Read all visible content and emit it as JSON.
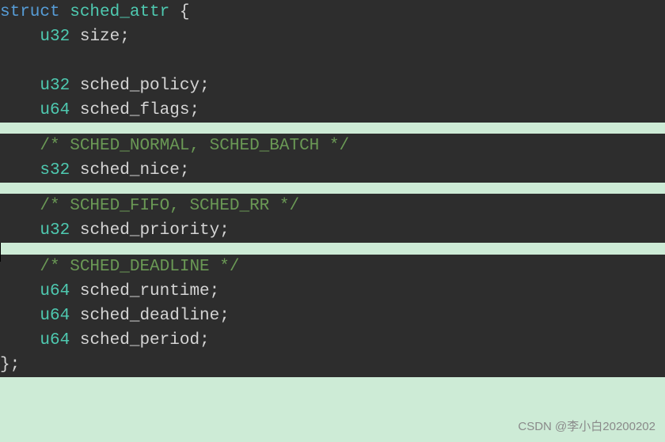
{
  "watermark": "CSDN @李小白20200202",
  "code": {
    "line1_kw": "struct",
    "line1_type": " sched_attr ",
    "line1_brace": "{",
    "indent": "    ",
    "line2_type": "u32",
    "line2_id": " size",
    "semi": ";",
    "line4_type": "u32",
    "line4_id": " sched_policy",
    "line5_type": "u64",
    "line5_id": " sched_flags",
    "comment1": "/* SCHED_NORMAL, SCHED_BATCH */",
    "line7_type": "s32",
    "line7_id": " sched_nice",
    "comment2": "/* SCHED_FIFO, SCHED_RR */",
    "line9_type": "u32",
    "line9_id": " sched_priority",
    "comment3": "/* SCHED_DEADLINE */",
    "line11_type": "u64",
    "line11_id": " sched_runtime",
    "line12_type": "u64",
    "line12_id": " sched_deadline",
    "line13_type": "u64",
    "line13_id": " sched_period",
    "close": "};"
  }
}
